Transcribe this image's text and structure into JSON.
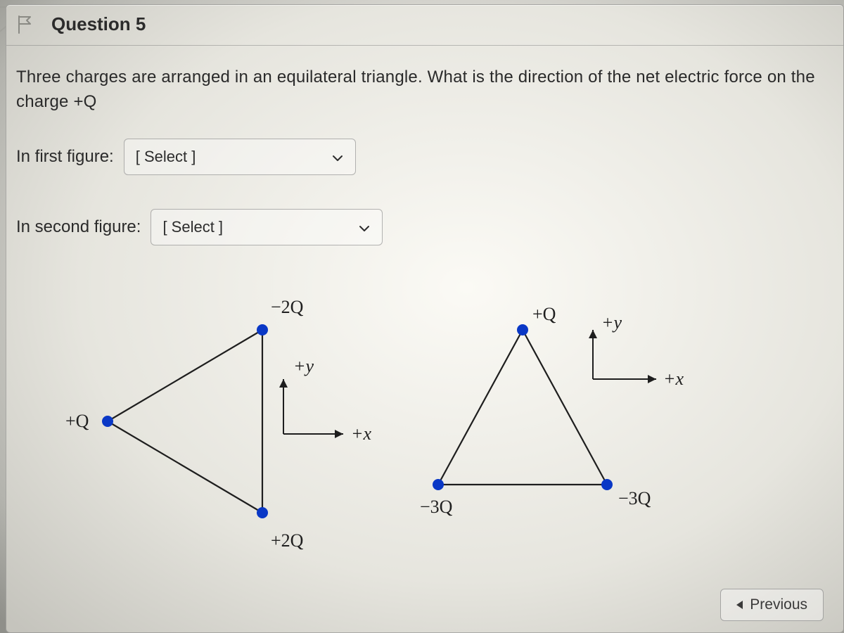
{
  "header": {
    "title": "Question 5"
  },
  "prompt": "Three charges are arranged in an equilateral triangle. What is the direction of the net electric force on the charge +Q",
  "rows": {
    "first": {
      "label": "In first figure:",
      "select_text": "[ Select ]"
    },
    "second": {
      "label": "In second figure:",
      "select_text": "[ Select ]"
    }
  },
  "figures": {
    "fig1": {
      "charges": {
        "left": {
          "label": "+Q"
        },
        "top": {
          "label": "−2Q"
        },
        "bottom": {
          "label": "+2Q"
        }
      },
      "axes": {
        "x": "+x",
        "y": "+y"
      }
    },
    "fig2": {
      "charges": {
        "apex": {
          "label": "+Q"
        },
        "bottomLeft": {
          "label": "−3Q"
        },
        "bottomRight": {
          "label": "−3Q"
        }
      },
      "axes": {
        "x": "+x",
        "y": "+y"
      }
    }
  },
  "footer": {
    "previous": "Previous"
  }
}
